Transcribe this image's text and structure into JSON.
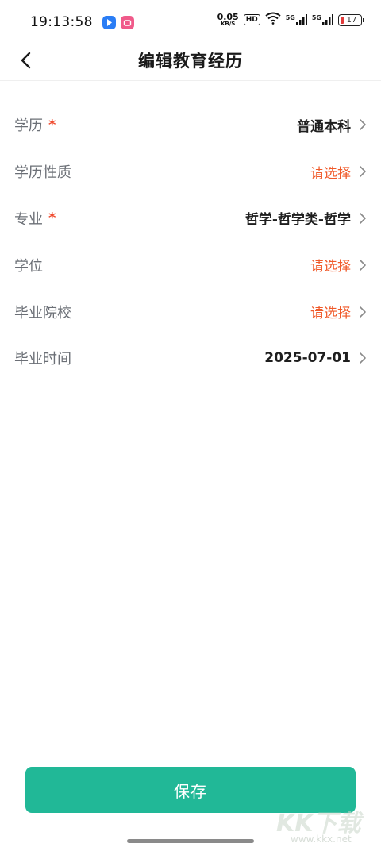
{
  "status_bar": {
    "time": "19:13:58",
    "net_speed_value": "0.05",
    "net_speed_unit": "KB/S",
    "hd_badge": "HD",
    "signal_1": "5G",
    "signal_2": "5G",
    "battery_level": "17",
    "icons": [
      "app-blue-icon",
      "app-pink-icon",
      "wifi-icon",
      "signal-icon",
      "signal-icon",
      "battery-icon"
    ],
    "battery_color": "#e23b3b"
  },
  "nav": {
    "title": "编辑教育经历",
    "back_icon": "chevron-left-icon"
  },
  "form": {
    "rows": [
      {
        "label": "学历",
        "required": true,
        "value": "普通本科",
        "is_placeholder": false
      },
      {
        "label": "学历性质",
        "required": false,
        "value": "请选择",
        "is_placeholder": true
      },
      {
        "label": "专业",
        "required": true,
        "value": "哲学-哲学类-哲学",
        "is_placeholder": false
      },
      {
        "label": "学位",
        "required": false,
        "value": "请选择",
        "is_placeholder": true
      },
      {
        "label": "毕业院校",
        "required": false,
        "value": "请选择",
        "is_placeholder": true
      },
      {
        "label": "毕业时间",
        "required": false,
        "value": "2025-07-01",
        "is_placeholder": false
      }
    ],
    "required_mark": "*"
  },
  "save_button": {
    "label": "保存",
    "color": "#21b897"
  },
  "colors": {
    "placeholder": "#f05a2a",
    "required": "#f04b2f",
    "accent": "#21b897"
  },
  "watermark": {
    "logo": "KK下载",
    "url": "www.kkx.net"
  }
}
